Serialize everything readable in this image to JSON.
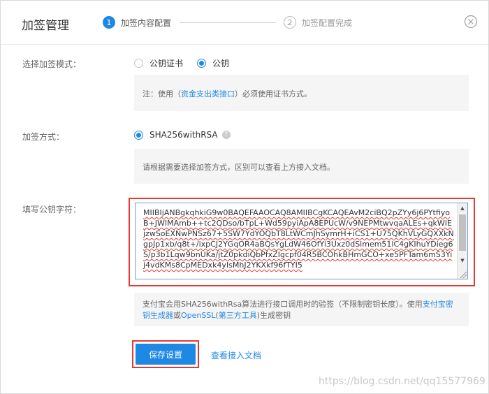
{
  "dialog": {
    "title": "加签管理",
    "steps": [
      {
        "num": "1",
        "label": "加签内容配置"
      },
      {
        "num": "2",
        "label": "加签配置完成"
      }
    ]
  },
  "mode": {
    "label": "选择加签模式：",
    "options": [
      "公钥证书",
      "公钥"
    ],
    "selected": "公钥",
    "note_prefix": "注：使用（",
    "note_link": "资金支出类接口",
    "note_suffix": "）必须使用证书方式。"
  },
  "method": {
    "label": "加签方式：",
    "option": "SHA256withRSA",
    "note": "请根据需要选择加签方式，区别可以查看上方接入文档。"
  },
  "public_key": {
    "label": "填写公钥字符：",
    "value": "MIIBIjANBgkqhkiG9w0BAQEFAAOCAQ8AMIIBCgKCAQEAvM2ciBQ2pZYy6j6PYtfiyoB+JWIMAmb++tc2QDso/bTpL+Wd59pyiApA8EPUcW/v9NEPMtwvqaALEs+qkWIEjzwSoEXNwPNSz67+5SW7YdYOQbT8LtWCmJhSymrH+iCS1+U75QKhVLyGQXXkNgpJp1xb/q8t+/ixpCJ2YGqOR4aBQsYgLdW46OfYi3Uxz0dSlmem51lC4gKIhuYDieg6S/p3b1Lqw9bnUKa/jtZ0pkdiQbPfxZIgcpf04R5BCOhkBHmGCO+xe5PFTam6mS3Yij4vdKMs8CpMEDxk4yIsMhJ2YKXkf96fTYI5",
    "note_prefix": "支付宝会用SHA256withRsa算法进行接口调用时的验签（不限制密钥长度）。使用",
    "note_link1": "支付宝密钥生成器",
    "note_mid1": "或",
    "note_link2": "OpenSSL",
    "note_mid2": "(",
    "note_link3": "第三方工具",
    "note_suffix": ")生成密钥"
  },
  "actions": {
    "save": "保存设置",
    "view_doc": "查看接入文档"
  },
  "watermark": "https://blog.csdn.net/qq15577969",
  "colors": {
    "accent": "#1e88e5",
    "highlight": "#e53935"
  }
}
